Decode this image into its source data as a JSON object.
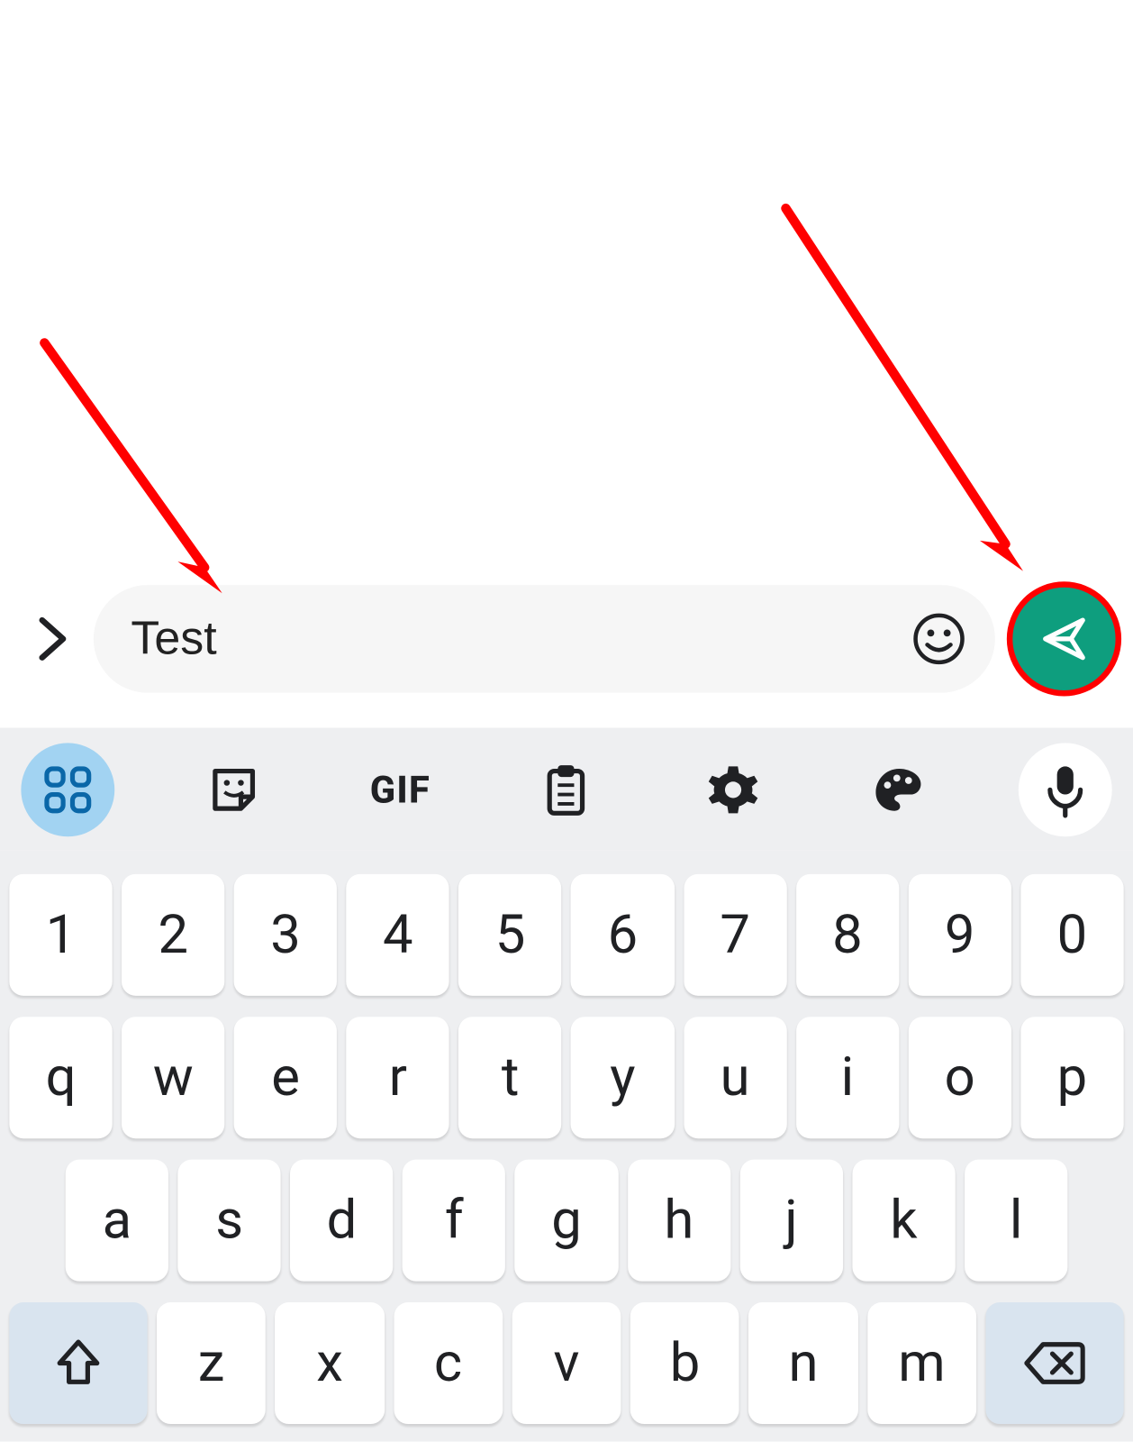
{
  "input": {
    "text": "Test"
  },
  "toolbar": {
    "gif_label": "GIF"
  },
  "keyboard": {
    "row1": [
      "1",
      "2",
      "3",
      "4",
      "5",
      "6",
      "7",
      "8",
      "9",
      "0"
    ],
    "row2": [
      "q",
      "w",
      "e",
      "r",
      "t",
      "y",
      "u",
      "i",
      "o",
      "p"
    ],
    "row3": [
      "a",
      "s",
      "d",
      "f",
      "g",
      "h",
      "j",
      "k",
      "l"
    ],
    "row4": [
      "z",
      "x",
      "c",
      "v",
      "b",
      "n",
      "m"
    ]
  },
  "colors": {
    "send_button": "#0e9e7e",
    "highlight": "#ff0000",
    "toolbar_active": "#a2d3f2"
  }
}
